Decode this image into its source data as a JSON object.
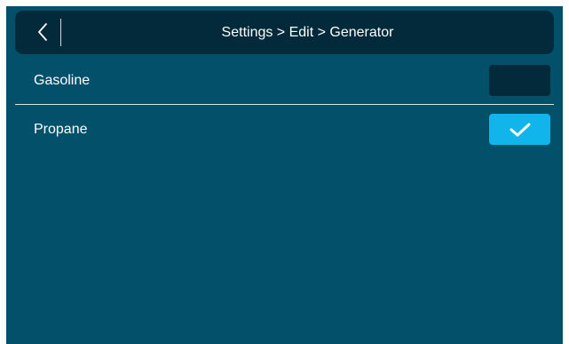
{
  "header": {
    "title": "Settings > Edit > Generator",
    "back_icon": "chevron-left-icon"
  },
  "options": [
    {
      "label": "Gasoline",
      "checked": false
    },
    {
      "label": "Propane",
      "checked": true,
      "check_icon": "checkmark-icon"
    }
  ],
  "colors": {
    "background": "#02506a",
    "header_bg": "#022a3a",
    "checkbox_off": "#022a3a",
    "checkbox_on": "#12b4ec",
    "text": "#ffffff"
  }
}
